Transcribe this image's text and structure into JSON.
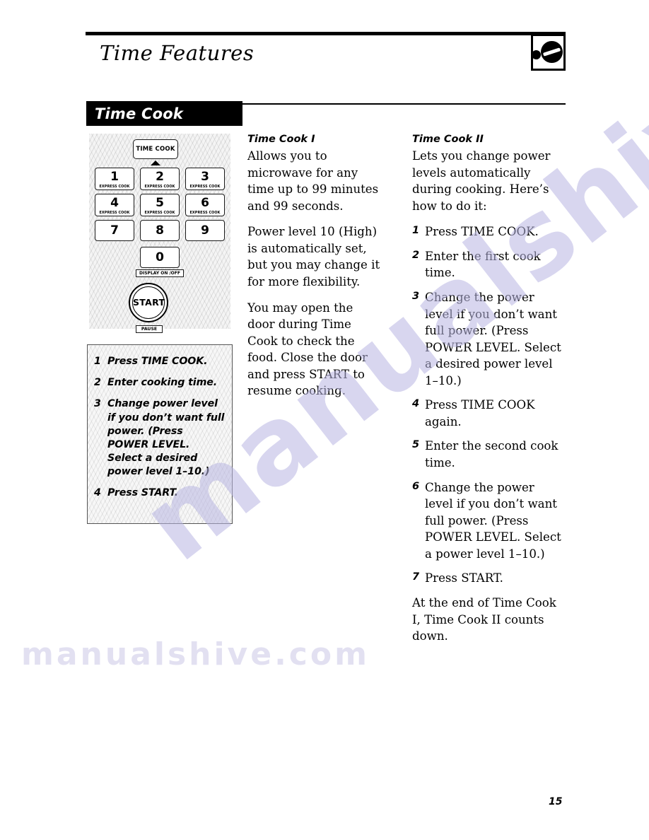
{
  "header": {
    "title": "Time Features",
    "corner_icon": "microwave-door-icon"
  },
  "section": {
    "title": "Time Cook"
  },
  "keypad": {
    "time_cook_button": "TIME COOK",
    "keys": [
      {
        "num": "1",
        "sub": "EXPRESS COOK"
      },
      {
        "num": "2",
        "sub": "EXPRESS COOK"
      },
      {
        "num": "3",
        "sub": "EXPRESS COOK"
      },
      {
        "num": "4",
        "sub": "EXPRESS COOK"
      },
      {
        "num": "5",
        "sub": "EXPRESS COOK"
      },
      {
        "num": "6",
        "sub": "EXPRESS COOK"
      },
      {
        "num": "7",
        "sub": ""
      },
      {
        "num": "8",
        "sub": ""
      },
      {
        "num": "9",
        "sub": ""
      },
      {
        "num": "0",
        "sub": ""
      }
    ],
    "display_tag": "DISPLAY ON /OFF",
    "start_button": "START",
    "pause_tag": "PAUSE"
  },
  "step_box": {
    "steps": [
      {
        "n": "1",
        "text": "Press TIME COOK."
      },
      {
        "n": "2",
        "text": "Enter cooking time."
      },
      {
        "n": "3",
        "text": "Change power level if you don’t want full power. (Press POWER LEVEL. Select a desired power level 1–10.)"
      },
      {
        "n": "4",
        "text": "Press START."
      }
    ]
  },
  "column_middle": {
    "heading": "Time Cook I",
    "paragraphs": [
      "Allows you to microwave for any time up to 99 minutes and 99 seconds.",
      "Power level 10 (High) is automatically set, but you may change it for more flexibility.",
      "You may open the door during Time Cook to check the food. Close the door and press START to resume cooking."
    ]
  },
  "column_right": {
    "heading": "Time Cook II",
    "intro": "Lets you change power levels automatically during cooking. Here’s how to do it:",
    "steps": [
      {
        "n": "1",
        "text": "Press TIME COOK."
      },
      {
        "n": "2",
        "text": "Enter the first cook time."
      },
      {
        "n": "3",
        "text": "Change the power level if you don’t want full power. (Press POWER LEVEL. Select a desired power level 1–10.)"
      },
      {
        "n": "4",
        "text": "Press TIME COOK again."
      },
      {
        "n": "5",
        "text": "Enter the second cook time."
      },
      {
        "n": "6",
        "text": "Change the power level if you don’t want full power. (Press POWER LEVEL. Select a power level 1–10.)"
      },
      {
        "n": "7",
        "text": "Press START."
      }
    ],
    "closing": "At the end of Time Cook I, Time Cook II counts down."
  },
  "footer": {
    "page_number": "15"
  },
  "watermark": {
    "line1": "manualshive.com",
    "line2": "manualshive.com"
  }
}
